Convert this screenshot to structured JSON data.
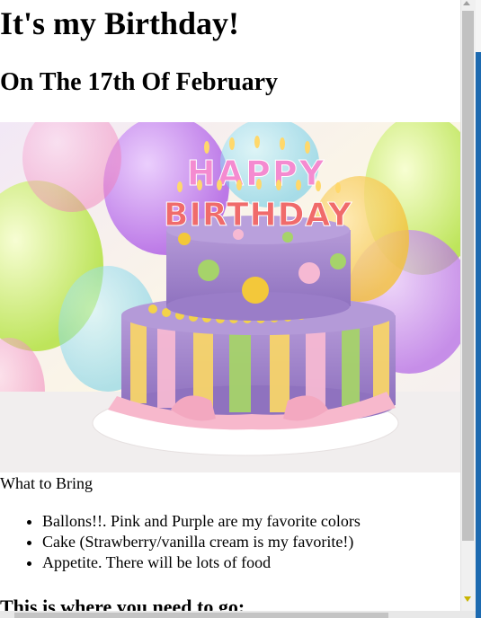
{
  "page": {
    "title": "It's my Birthday!",
    "subtitle": "On The 17th Of February",
    "caption": "What to Bring",
    "bring_items": [
      "Ballons!!. Pink and Purple are my favorite colors",
      "Cake (Strawberry/vanilla cream is my favorite!)",
      "Appetite. There will be lots of food"
    ],
    "directions_heading": "This is where you need to go:"
  },
  "image": {
    "alt": "Birthday cake with HAPPY BIRTHDAY candles",
    "candle_text_1": "HAPPY",
    "candle_text_2": "BIRTHDAY"
  },
  "colors": {
    "background": "#ffffff",
    "scrollbar_thumb": "#c1c1c1",
    "accent_blue": "#1d6ab0"
  }
}
